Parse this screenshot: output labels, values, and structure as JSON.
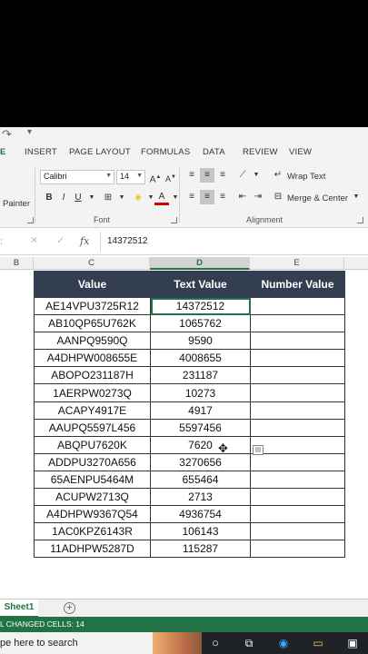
{
  "ribbon": {
    "tabs": [
      "E",
      "INSERT",
      "PAGE LAYOUT",
      "FORMULAS",
      "DATA",
      "REVIEW",
      "VIEW"
    ],
    "font_name": "Calibri",
    "font_size": "14",
    "painter_label": "Painter",
    "font_group_label": "Font",
    "alignment_group_label": "Alignment",
    "wrap_text_label": "Wrap Text",
    "merge_center_label": "Merge & Center"
  },
  "formula_bar": {
    "value": "14372512"
  },
  "column_headers": [
    "B",
    "C",
    "D",
    "E"
  ],
  "table": {
    "headers": [
      "Value",
      "Text Value",
      "Number Value"
    ],
    "rows": [
      [
        "AE14VPU3725R12",
        "14372512",
        ""
      ],
      [
        "AB10QP65U762K",
        "1065762",
        ""
      ],
      [
        "AANPQ9590Q",
        "9590",
        ""
      ],
      [
        "A4DHPW008655E",
        "4008655",
        ""
      ],
      [
        "ABOPO231187H",
        "231187",
        ""
      ],
      [
        "1AERPW0273Q",
        "10273",
        ""
      ],
      [
        "ACAPY4917E",
        "4917",
        ""
      ],
      [
        "AAUPQ5597L456",
        "5597456",
        ""
      ],
      [
        "ABQPU7620K",
        "7620",
        ""
      ],
      [
        "ADDPU3270A656",
        "3270656",
        ""
      ],
      [
        "65AENPU5464M",
        "655464",
        ""
      ],
      [
        "ACUPW2713Q",
        "2713",
        ""
      ],
      [
        "A4DHPW9367Q54",
        "4936754",
        ""
      ],
      [
        "1AC0KPZ6143R",
        "106143",
        ""
      ],
      [
        "11ADHPW5287D",
        "115287",
        ""
      ]
    ]
  },
  "sheet_tab": "Sheet1",
  "status_text": "L CHANGED CELLS: 14",
  "taskbar": {
    "search_text": "pe here to search"
  },
  "colors": {
    "header_bg": "#333f50",
    "excel_green": "#217346"
  }
}
